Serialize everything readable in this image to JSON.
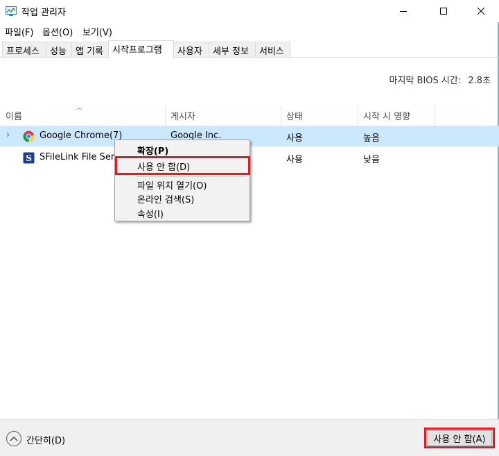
{
  "window": {
    "title": "작업 관리자"
  },
  "menu": [
    "파일(F)",
    "옵션(O)",
    "보기(V)"
  ],
  "tabs": [
    {
      "label": "프로세스"
    },
    {
      "label": "성능"
    },
    {
      "label": "앱 기록"
    },
    {
      "label": "시작프로그램",
      "active": true
    },
    {
      "label": "사용자"
    },
    {
      "label": "세부 정보"
    },
    {
      "label": "서비스"
    }
  ],
  "bios": {
    "label": "마지막 BIOS 시간:",
    "value": "2.8초"
  },
  "columns": [
    "이름",
    "게시자",
    "상태",
    "시작 시 영향"
  ],
  "rows": [
    {
      "name": "Google Chrome(7)",
      "publisher": "Google Inc.",
      "status": "사용",
      "impact": "높음",
      "icon": "chrome-icon",
      "selected": true
    },
    {
      "name": "SFileLink File Serv",
      "publisher": "",
      "status": "사용",
      "impact": "낮음",
      "icon": "sfilelink-icon"
    }
  ],
  "context_menu": {
    "items": [
      "확장(P)",
      "사용 안 함(D)",
      "파일 위치 열기(O)",
      "온라인 검색(S)",
      "속성(I)"
    ]
  },
  "footer": {
    "collapse_label": "간단히(D)",
    "disable_button": "사용 안 함(A)"
  },
  "colors": {
    "selection": "#cce8ff",
    "highlight_box": "#e21a22"
  }
}
